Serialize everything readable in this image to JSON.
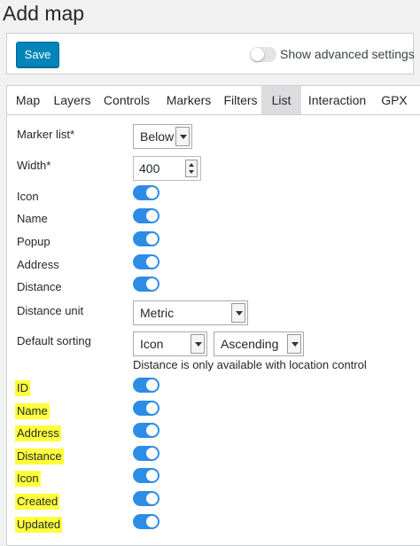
{
  "page": {
    "title": "Add map"
  },
  "toolbar": {
    "save_label": "Save",
    "advanced_label": "Show advanced settings"
  },
  "tabs": [
    {
      "label": "Map"
    },
    {
      "label": "Layers"
    },
    {
      "label": "Controls"
    },
    {
      "label": "Markers"
    },
    {
      "label": "Filters"
    },
    {
      "label": "List"
    },
    {
      "label": "Interaction"
    },
    {
      "label": "GPX"
    }
  ],
  "active_tab": "List",
  "form": {
    "marker_list": {
      "label": "Marker list*",
      "value": "Below"
    },
    "width": {
      "label": "Width*",
      "value": "400"
    },
    "icon": {
      "label": "Icon",
      "on": true
    },
    "name": {
      "label": "Name",
      "on": true
    },
    "popup": {
      "label": "Popup",
      "on": true
    },
    "address": {
      "label": "Address",
      "on": true
    },
    "distance": {
      "label": "Distance",
      "on": true
    },
    "distance_unit": {
      "label": "Distance unit",
      "value": "Metric"
    },
    "default_sorting": {
      "label": "Default sorting",
      "field": "Icon",
      "order": "Ascending"
    },
    "note": "Distance is only available with location control",
    "sort_fields": [
      {
        "label": "ID",
        "on": true
      },
      {
        "label": "Name",
        "on": true
      },
      {
        "label": "Address",
        "on": true
      },
      {
        "label": "Distance",
        "on": true
      },
      {
        "label": "Icon",
        "on": true
      },
      {
        "label": "Created",
        "on": true
      },
      {
        "label": "Updated",
        "on": true
      }
    ]
  },
  "colors": {
    "accent": "#0085ba",
    "toggle_on": "#2d8ce6",
    "highlight": "#ffff3c"
  }
}
